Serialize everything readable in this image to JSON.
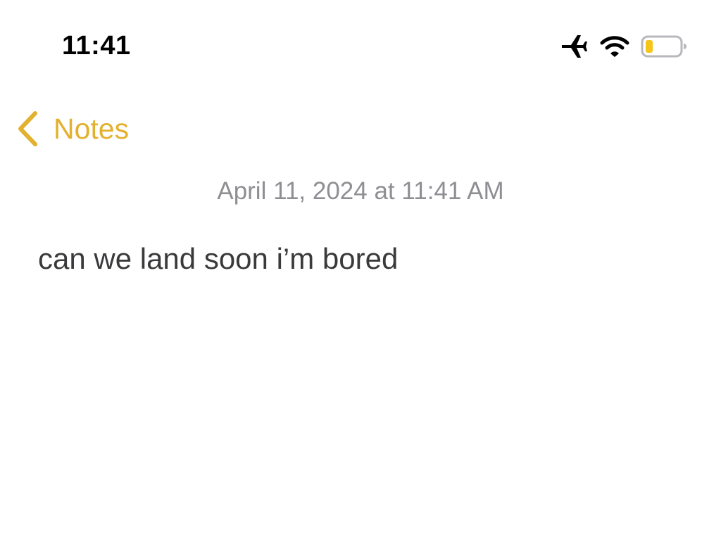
{
  "status_bar": {
    "time": "11:41",
    "airplane_mode": "airplane-icon",
    "wifi": "wifi-icon",
    "battery": {
      "icon": "battery-icon",
      "level": 0.15,
      "low_power_color": "#F5C518"
    }
  },
  "nav": {
    "back_icon": "chevron-left-icon",
    "back_label": "Notes",
    "accent_color": "#E2B12F"
  },
  "note": {
    "date": "April 11, 2024 at 11:41 AM",
    "body": "can we land soon i’m bored"
  }
}
